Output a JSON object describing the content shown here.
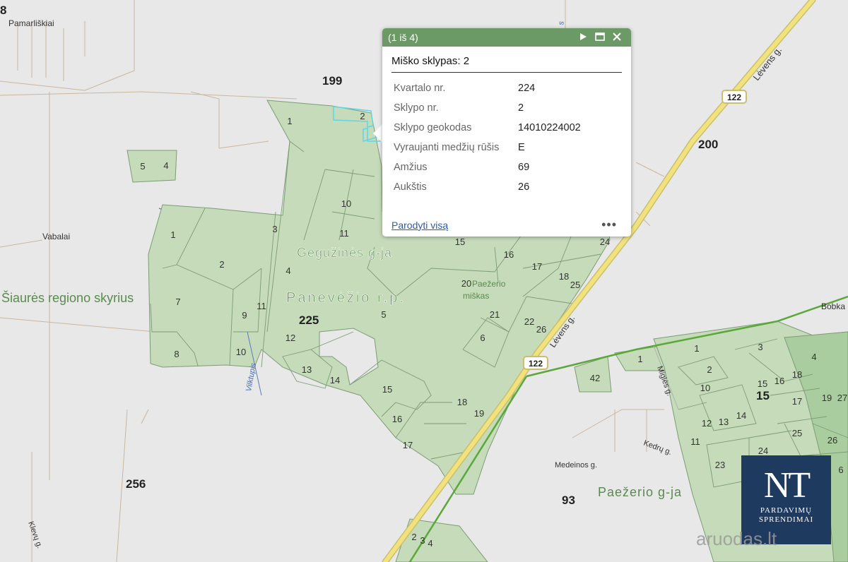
{
  "popup": {
    "counter": "(1 iš 4)",
    "title": "Miško sklypas: 2",
    "attributes": [
      {
        "key": "Kvartalo nr.",
        "value": "224"
      },
      {
        "key": "Sklypo nr.",
        "value": "2"
      },
      {
        "key": "Sklypo geokodas",
        "value": "14010224002"
      },
      {
        "key": "Vyraujanti medžių rūšis",
        "value": "E"
      },
      {
        "key": "Amžius",
        "value": "69"
      },
      {
        "key": "Aukštis",
        "value": "26"
      }
    ],
    "show_all_link": "Parodyti visą",
    "more": "•••"
  },
  "map": {
    "places": {
      "pamarliskiai": "Pamarliškiai",
      "vabalai": "Vabalai",
      "siaures": "Šiaurės regiono skyrius",
      "geguzines": "Gegužinės g-ja",
      "panevezio": "Panevėžio r.p.",
      "paezerio_miskas_1": "Paežerio",
      "paezerio_miskas_2": "miškas",
      "paezerio_gja": "Paežerio g-ja",
      "bobka": "Bobka"
    },
    "roads": {
      "levens_top": "Lėvens g.",
      "levens_mid": "Lėvens g.",
      "route_top": "122",
      "route_mid": "122",
      "vilktupis": "Vilktupis",
      "migles": "Miglės g.",
      "medeinos": "Medeinos g.",
      "kedru": "Kedrų g.",
      "klevu": "Klevų g.",
      "top_road": "s"
    },
    "quarters": {
      "q199": "199",
      "q200": "200",
      "q225": "225",
      "q256": "256",
      "q93": "93",
      "q15": "15",
      "q8": "8"
    },
    "plots": {
      "p1": "1",
      "p2": "2",
      "p5": "5",
      "p4": "4",
      "p10": "10",
      "p11": "11",
      "w1": "1",
      "w2": "2",
      "w3": "3",
      "w4": "4",
      "w7": "7",
      "w8": "8",
      "w9": "9",
      "w10": "10",
      "w11": "11",
      "w12": "12",
      "w13": "13",
      "w14": "14",
      "w15": "15",
      "w16": "16",
      "w17": "17",
      "w18": "18",
      "w19": "19",
      "w5": "5",
      "e15": "15",
      "e16": "16",
      "e17": "17",
      "e18": "18",
      "e20": "20",
      "e21": "21",
      "e22": "22",
      "e24": "24",
      "e25": "25",
      "e26": "26",
      "e6": "6",
      "r1": "1",
      "r2": "2",
      "r3": "3",
      "r4": "4",
      "r10": "10",
      "r11": "11",
      "r12": "12",
      "r13": "13",
      "r14": "14",
      "r15": "15",
      "r16": "16",
      "r17": "17",
      "r18": "18",
      "r19": "19",
      "r23": "23",
      "r24": "24",
      "r25": "25",
      "r26": "26",
      "r27": "27",
      "r42": "42",
      "r1b": "1",
      "r6": "6",
      "b3": "3",
      "b4": "4",
      "b2": "2"
    }
  },
  "logo": {
    "main": "NT",
    "line1": "PARDAVIMŲ",
    "line2": "SPRENDIMAI"
  },
  "watermark": "aruodas.lt",
  "colors": {
    "forest": "#c5dbb9",
    "forest_border": "#7d9c75",
    "background": "#e8e8e8",
    "road_yellow": "#f1e27e",
    "route_green": "#5aa83a",
    "popup_header": "#6b9a66",
    "highlight": "#5fd6e6"
  }
}
